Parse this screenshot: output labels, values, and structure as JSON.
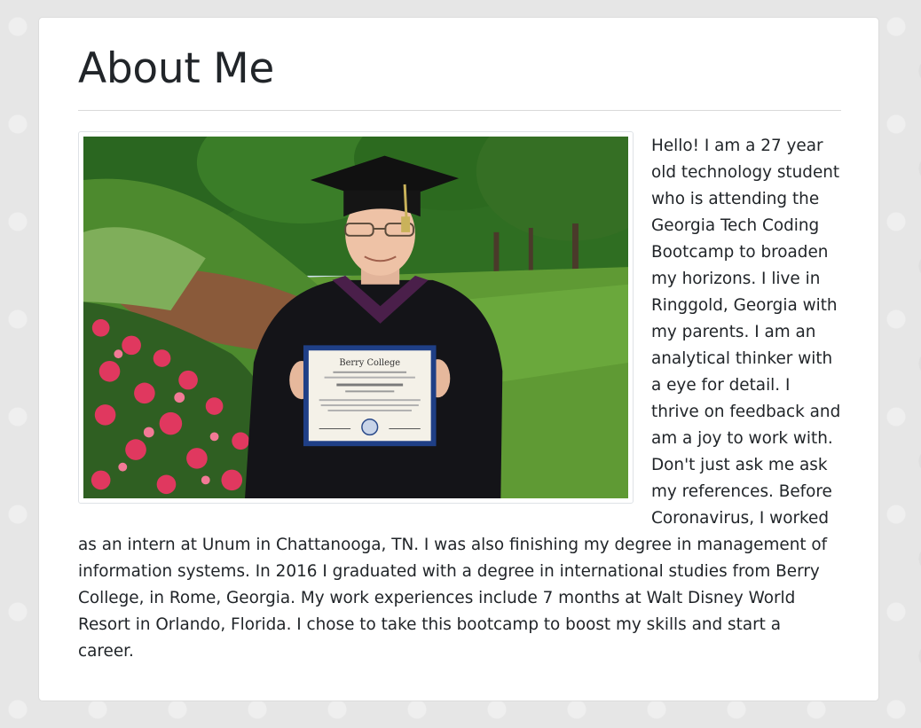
{
  "page": {
    "title": "About Me",
    "bio": "Hello! I am a 27 year old technology student who is attending the Georgia Tech Coding Bootcamp to broaden my horizons. I live in Ringgold, Georgia with my parents. I am an analytical thinker with a eye for detail. I thrive on feedback and am a joy to work with. Don't just ask me ask my references. Before Coronavirus, I worked as an intern at Unum in Chattanooga, TN. I was also finishing my degree in management of information systems. In 2016 I graduated with a degree in international studies from Berry College, in Rome, Georgia. My work experiences include 7 months at Walt Disney World Resort in Orlando, Florida. I chose to take this bootcamp to boost my skills and start a career."
  },
  "photo": {
    "diploma_heading": "Berry College",
    "colors": {
      "sky": "#cfe3ee",
      "trees": "#2f6e22",
      "grass": "#5f9a34",
      "gown": "#141418",
      "flowers": "#e0385f",
      "diploma_cover": "#1f3f86"
    }
  }
}
